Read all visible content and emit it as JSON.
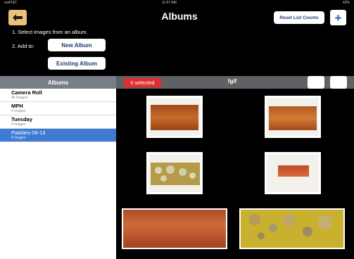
{
  "status_bar": {
    "carrier": "ooAT&T",
    "time": "11:57 AM",
    "battery": "43%"
  },
  "header": {
    "title": "Albums",
    "reset_label": "Reset List Counts",
    "add_label": "+"
  },
  "instructions": {
    "step1": "1. Select images from an album.",
    "step2": "2. Add to:",
    "new_album_label": "New Album",
    "existing_album_label": "Existing Album"
  },
  "sidebar": {
    "header": "Albums",
    "items": [
      {
        "name": "Camera Roll",
        "count": "46 Images",
        "selected": false
      },
      {
        "name": "MPH",
        "count": "4 Images",
        "selected": false
      },
      {
        "name": "Tuesday",
        "count": "0 Images",
        "selected": false
      },
      {
        "name": "Paddies 09-13",
        "count": "8 Images",
        "selected": true
      }
    ]
  },
  "grid": {
    "selected_label": "0 selected",
    "album_name": "fgif",
    "thumbnail_count": 6
  },
  "colors": {
    "accent_back": "#e8c27a",
    "selected_row": "#3d7bd4",
    "selected_badge": "#e02e2e"
  }
}
